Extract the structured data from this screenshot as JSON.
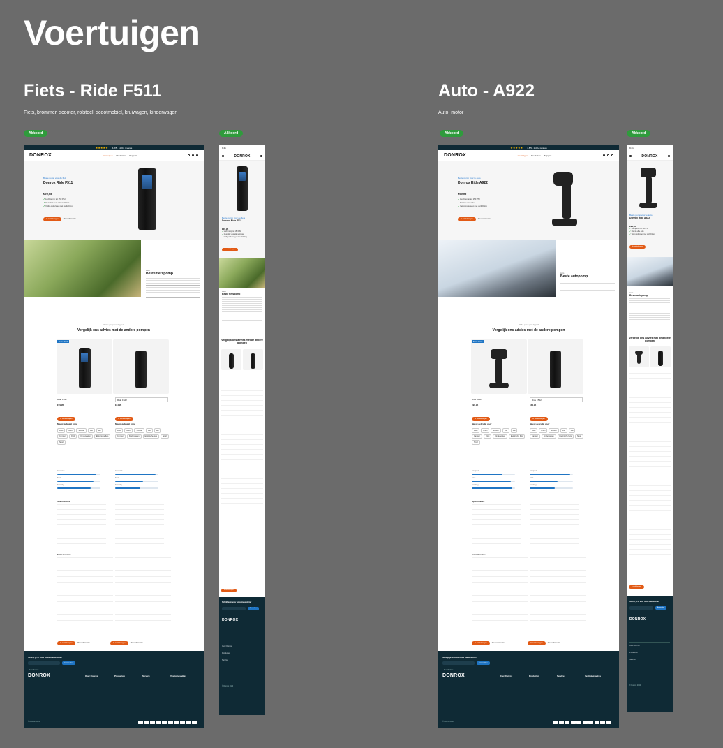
{
  "page_title": "Voertuigen",
  "sections": [
    {
      "title": "Fiets - Ride F511",
      "subtitle": "Fiets, brommer, scooter, rolstoel, scootmobiel, kruiwagen, kinderwagen"
    },
    {
      "title": "Auto - A922",
      "subtitle": "Auto, motor"
    }
  ],
  "badge": "Akkoord",
  "colors": {
    "background": "#6b6b6b",
    "accent": "#e25a15",
    "brand_dark": "#0f2a35",
    "badge": "#2f9b3c",
    "link_blue": "#1f75c4"
  },
  "mock": {
    "brand": "DONROX",
    "nav": [
      "Voertuigen",
      "Producten",
      "Support"
    ],
    "topbar": "4.8/5 · 1100+ reviews",
    "topbar_right": [
      "Over ons",
      "Blog",
      "Nederlands"
    ],
    "buy_button": "In winkelwagen",
    "more_link": "Meer informatie",
    "compare_kicker": "Welke pomp past bij jou?",
    "compare_title": "Vergelijk ons advies met de andere pompen",
    "compare_badge": "Beste Match",
    "used_for": "Meest gebruikt voor",
    "specs_title": "Specificaties",
    "extras_title": "Extra functies",
    "newsletter": "Schrijf je in voor onze nieuwsbrief",
    "newsletter_placeholder": "E-mailadres",
    "newsletter_button": "Aanmelden",
    "footer_cols": [
      "Over Donrox",
      "Producten",
      "Service",
      "Vestigingsadres"
    ],
    "copyright": "© Donrox 2024"
  },
  "fiets": {
    "kicker": "Beste pomp voor de fiets",
    "product": "Donrox Ride F511",
    "price": "€29,95",
    "checks": [
      "Luchtpomp tot 150 PSI",
      "Geschikt voor alle ventielen",
      "Veilig onderweg met verlichting"
    ],
    "feature_kicker": "Fiets",
    "feature_title": "Beste fietspomp",
    "compare_names": [
      "Ride F511",
      "Ride F522"
    ],
    "compare_prices": [
      "€79,95",
      "€44,95"
    ],
    "chips_left": [
      "Fiets",
      "Brom",
      "Scooter",
      "Rol",
      "Bal",
      "Camper",
      "Oprit",
      "Kinderwagen",
      "Elektrische fiets",
      "Sport"
    ],
    "chips_right": [
      "Fiets",
      "Brom",
      "Scooter",
      "Rol",
      "Bal",
      "Camper",
      "Kinderwagen",
      "Elektrische fiets",
      "Sport"
    ],
    "meters": [
      "Compact",
      "Snel",
      "Krachtig"
    ]
  },
  "auto": {
    "kicker": "Beste pomp voor je auto",
    "product": "Donrox Ride A922",
    "price": "€99,95",
    "checks": [
      "Luchtpomp tot 150 PSI",
      "Past in elke auto",
      "Veilig onderweg met verlichting"
    ],
    "feature_kicker": "Auto",
    "feature_title": "Beste autopomp",
    "compare_names": [
      "Ride A922",
      "Ride F522"
    ],
    "compare_prices": [
      "€99,95",
      "€44,95"
    ],
    "meters": [
      "Compact",
      "Snel",
      "Krachtig"
    ]
  }
}
